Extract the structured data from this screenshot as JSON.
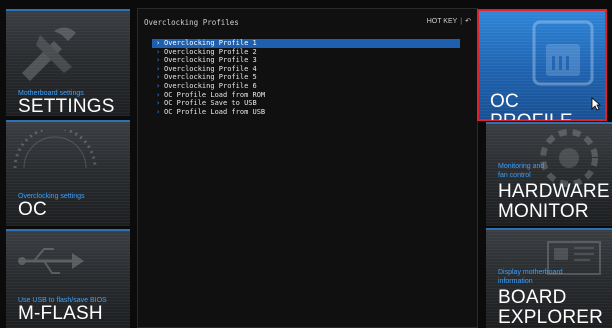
{
  "left_tiles": {
    "settings": {
      "subtitle": "Motherboard settings",
      "title": "SETTINGS"
    },
    "oc": {
      "subtitle": "Overclocking settings",
      "title": "OC"
    },
    "mflash": {
      "subtitle": "Use USB to flash/save BIOS",
      "title": "M-FLASH"
    }
  },
  "right_tiles": {
    "oc_profile": {
      "title": "OC PROFILE",
      "selected": true,
      "highlight_color": "#e0202a"
    },
    "hardware_monitor": {
      "subtitle": "Monitoring and\nfan control",
      "title": "HARDWARE\nMONITOR"
    },
    "board_explorer": {
      "subtitle": "Display motherboard\ninformation",
      "title": "BOARD\nEXPLORER"
    }
  },
  "center": {
    "title": "Overclocking Profiles",
    "hotkey_label": "HOT KEY",
    "hotkey_separator": "|",
    "back_glyph": "↶",
    "menu": [
      {
        "label": "Overclocking Profile 1",
        "selected": true
      },
      {
        "label": "Overclocking Profile 2",
        "selected": false
      },
      {
        "label": "Overclocking Profile 3",
        "selected": false
      },
      {
        "label": "Overclocking Profile 4",
        "selected": false
      },
      {
        "label": "Overclocking Profile 5",
        "selected": false
      },
      {
        "label": "Overclocking Profile 6",
        "selected": false
      },
      {
        "label": "OC Profile Load from ROM",
        "selected": false
      },
      {
        "label": "OC Profile Save to USB",
        "selected": false
      },
      {
        "label": "OC Profile Load from USB",
        "selected": false
      }
    ]
  },
  "colors": {
    "accent_blue": "#2e8bff",
    "selection_blue": "#1f5fb0",
    "active_tile_blue": "#2f86d8",
    "subtitle_blue": "#3aa1ff"
  },
  "icons": [
    "tools-icon",
    "gauge-icon",
    "usb-icon",
    "sd-card-icon",
    "fan-icon",
    "motherboard-icon",
    "chevron-right-icon",
    "back-arrow-icon",
    "mouse-cursor-icon"
  ]
}
